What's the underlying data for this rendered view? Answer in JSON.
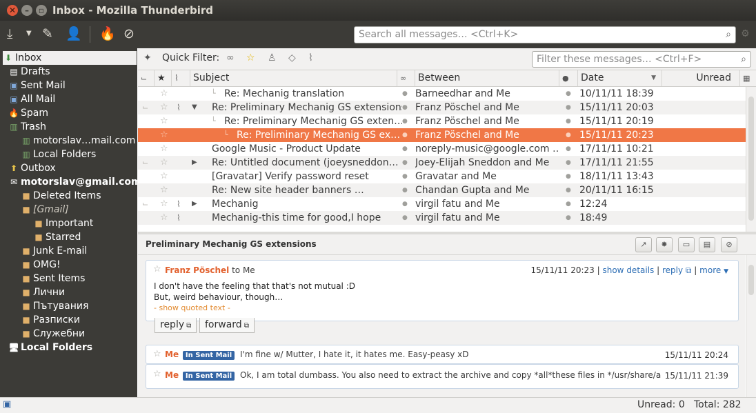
{
  "window": {
    "title": "Inbox - Mozilla Thunderbird"
  },
  "toolbar": {
    "search_placeholder": "Search all messages… <Ctrl+K>"
  },
  "sidebar": {
    "folders": [
      {
        "label": "Inbox",
        "icon": "inbox-icon",
        "selected": true
      },
      {
        "label": "Drafts",
        "icon": "drafts-icon"
      },
      {
        "label": "Sent Mail",
        "icon": "sent-icon"
      },
      {
        "label": "All Mail",
        "icon": "archive-icon"
      },
      {
        "label": "Spam",
        "icon": "spam-icon"
      },
      {
        "label": "Trash",
        "icon": "trash-icon"
      },
      {
        "label": "motorslav…mail.com",
        "icon": "trash-icon"
      },
      {
        "label": "Local Folders",
        "icon": "trash-icon"
      },
      {
        "label": "Outbox",
        "icon": "outbox-icon"
      },
      {
        "label": "motorslav@gmail.com",
        "icon": "account-icon",
        "bold": true
      },
      {
        "label": "Deleted Items",
        "icon": "folder-icon"
      },
      {
        "label": "[Gmail]",
        "icon": "folder-icon",
        "italic": true
      },
      {
        "label": "Important",
        "icon": "folder-icon"
      },
      {
        "label": "Starred",
        "icon": "folder-icon"
      },
      {
        "label": "Junk E-mail",
        "icon": "folder-icon"
      },
      {
        "label": "OMG!",
        "icon": "folder-icon"
      },
      {
        "label": "Sent Items",
        "icon": "folder-icon"
      },
      {
        "label": "Лични",
        "icon": "folder-icon"
      },
      {
        "label": "Пътувания",
        "icon": "folder-icon"
      },
      {
        "label": "Разписки",
        "icon": "folder-icon"
      },
      {
        "label": "Служебни",
        "icon": "folder-icon"
      },
      {
        "label": "Local Folders",
        "icon": "computer-icon",
        "bold": true
      }
    ]
  },
  "quickfilter": {
    "label": "Quick Filter:",
    "search_placeholder": "Filter these messages… <Ctrl+F>"
  },
  "columns": {
    "subject": "Subject",
    "between": "Between",
    "date": "Date",
    "unread": "Unread"
  },
  "messages": [
    {
      "subject": "Re: Mechanig translation",
      "between": "Barneedhar and Me",
      "date": "10/11/11 18:39"
    },
    {
      "subject": "Re: Preliminary Mechanig GS extensions",
      "between": "Franz Pöschel and Me",
      "date": "15/11/11 20:03"
    },
    {
      "subject": "Re: Preliminary Mechanig GS exten…",
      "between": "Franz Pöschel and Me",
      "date": "15/11/11 20:19"
    },
    {
      "subject": "Re: Preliminary Mechanig GS ex…",
      "between": "Franz Pöschel and Me",
      "date": "15/11/11 20:23"
    },
    {
      "subject": "Google Music - Product Update",
      "between": "noreply-music@google.com …",
      "date": "17/11/11 10:21"
    },
    {
      "subject": "Re: Untitled document (joeysneddon…",
      "between": "Joey-Elijah Sneddon and Me",
      "date": "17/11/11 21:55"
    },
    {
      "subject": "[Gravatar] Verify password reset",
      "between": "Gravatar and Me",
      "date": "18/11/11 13:43"
    },
    {
      "subject": "Re: New site header banners …",
      "between": "Chandan Gupta and Me",
      "date": "20/11/11 16:15"
    },
    {
      "subject": "Mechanig",
      "between": "virgil fatu and Me",
      "date": "12:24"
    },
    {
      "subject": "Mechanig-this time for good,I hope",
      "between": "virgil fatu and Me",
      "date": "18:49"
    }
  ],
  "conversation": {
    "title": "Preliminary Mechanig GS extensions",
    "msg1": {
      "from": "Franz Pöschel",
      "to": "to Me",
      "date": "15/11/11 20:23",
      "show_details": "show details",
      "reply": "reply",
      "more": "more",
      "line1": "I don't have the feeling that that's not mutual :D",
      "line2": "But, weird behaviour, though…",
      "quoted": "- show quoted text -",
      "btn_reply": "reply",
      "btn_forward": "forward"
    },
    "msg2": {
      "from": "Me",
      "badge": "In Sent Mail",
      "snippet": "I'm fine w/ Mutter, I hate it, it hates me. Easy-peasy xD",
      "date": "15/11/11 20:24"
    },
    "msg3": {
      "from": "Me",
      "badge": "In Sent Mail",
      "snippet": "Ok, I am total dumbass. You also need to extract the archive and copy *all*these files in */usr/share/applications/*",
      "date": "15/11/11 21:39"
    }
  },
  "status": {
    "unread": "Unread: 0",
    "total": "Total: 282"
  }
}
